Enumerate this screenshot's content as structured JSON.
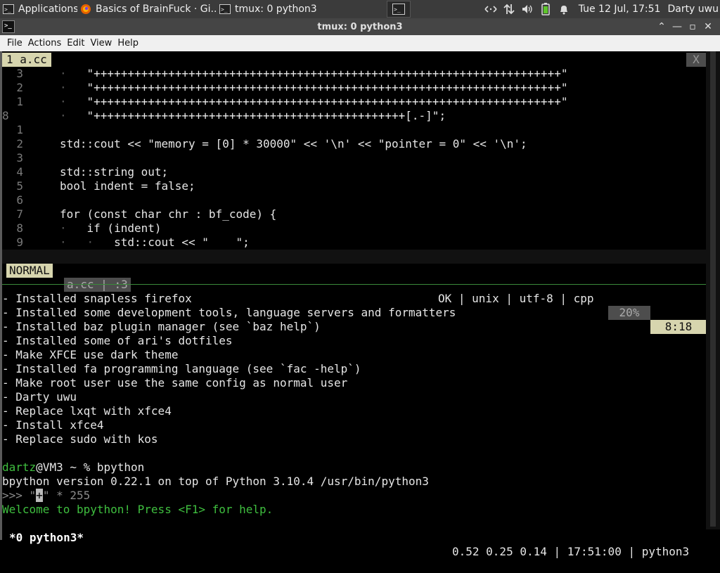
{
  "panel": {
    "applications": "Applications",
    "task_browser": "Basics of BrainFuck · Gi...",
    "task_terminal": "tmux: 0 python3",
    "clock": "Tue 12 Jul, 17:51",
    "user": "Darty uwu"
  },
  "window": {
    "title": "tmux: 0 python3",
    "menu": [
      "File",
      "Actions",
      "Edit",
      "View",
      "Help"
    ]
  },
  "editor": {
    "tab_label": "1 a.cc",
    "close_label": "X",
    "lines": [
      {
        "num": "3",
        "prefix": "·   ",
        "text": "\"+++++++++++++++++++++++++++++++++++++++++++++++++++++++++++++++++++++\""
      },
      {
        "num": "2",
        "prefix": "·   ",
        "text": "\"+++++++++++++++++++++++++++++++++++++++++++++++++++++++++++++++++++++\""
      },
      {
        "num": "1",
        "prefix": "·   ",
        "text": "\"+++++++++++++++++++++++++++++++++++++++++++++++++++++++++++++++++++++\""
      },
      {
        "num": "8",
        "prefix": "·   ",
        "text": "\"++++++++++++++++++++++++++++++++++++++++++++++[.-]\";"
      },
      {
        "num": "1",
        "prefix": "",
        "text": ""
      },
      {
        "num": "2",
        "prefix": "",
        "text": "std::cout << \"memory = [0] * 30000\" << '\\n' << \"pointer = 0\" << '\\n';"
      },
      {
        "num": "3",
        "prefix": "",
        "text": ""
      },
      {
        "num": "4",
        "prefix": "",
        "text": "std::string out;"
      },
      {
        "num": "5",
        "prefix": "",
        "text": "bool indent = false;"
      },
      {
        "num": "6",
        "prefix": "",
        "text": ""
      },
      {
        "num": "7",
        "prefix": "",
        "text": "for (const char chr : bf_code) {"
      },
      {
        "num": "8",
        "prefix": "·   ",
        "text": "if (indent)"
      },
      {
        "num": "9",
        "prefix": "·   ·   ",
        "text": "std::cout << \"    \";"
      }
    ],
    "status": {
      "mode": "NORMAL",
      "file": "a.cc",
      "sep": ":3",
      "info": "OK | unix | utf-8 | cpp",
      "percent": "20%",
      "position": "8:18"
    }
  },
  "shell": {
    "log": [
      "- Installed snapless firefox",
      "- Installed some development tools, language servers and formatters",
      "- Installed baz plugin manager (see `baz help`)",
      "- Installed some of ari's dotfiles",
      "- Make XFCE use dark theme",
      "- Installed fa programming language (see `fac -help`)",
      "- Make root user use the same config as normal user",
      "- Darty uwu",
      "- Replace lxqt with xfce4",
      "- Install xfce4",
      "- Replace sudo with kos"
    ],
    "prompt_user": "dartz",
    "prompt_rest": "@VM3 ~ % bpython",
    "version_line": "bpython version 0.22.1 on top of Python 3.10.4 /usr/bin/python3",
    "input_prefix": ">>> ",
    "input_quote_open": "\"",
    "input_cursor_char": "+",
    "input_rest": "\" * 255",
    "welcome": "Welcome to bpython! Press <F1> for help."
  },
  "tmux": {
    "window_label": "*0 python3*",
    "status_right": "0.52 0.25 0.14 | 17:51:00 | python3"
  }
}
